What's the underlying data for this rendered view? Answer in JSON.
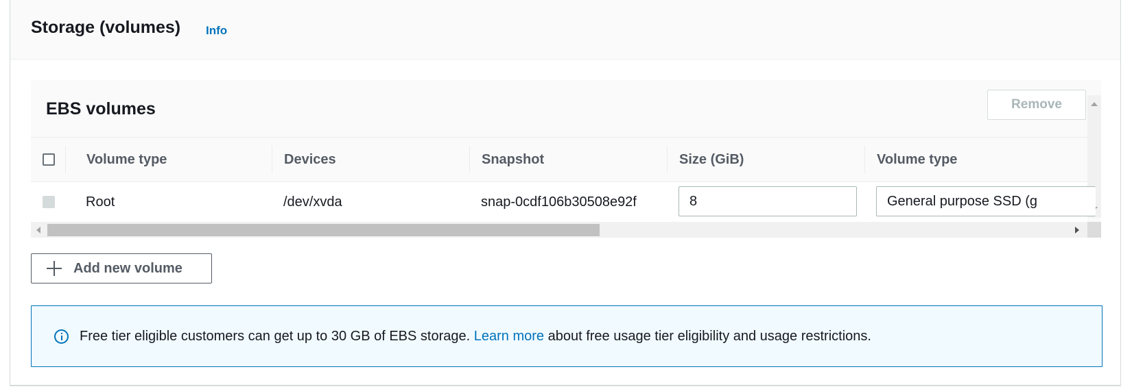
{
  "storage": {
    "title": "Storage (volumes)",
    "info_link": "Info"
  },
  "ebs": {
    "title": "EBS volumes",
    "remove_label": "Remove",
    "columns": [
      "Volume type",
      "Devices",
      "Snapshot",
      "Size (GiB)",
      "Volume type"
    ],
    "rows": [
      {
        "volume_type": "Root",
        "device": "/dev/xvda",
        "snapshot": "snap-0cdf106b30508e92f",
        "size": "8",
        "volume_type_select": "General purpose SSD (g"
      }
    ]
  },
  "add_volume_label": "Add new volume",
  "notice": {
    "text_before": "Free tier eligible customers can get up to 30 GB of EBS storage. ",
    "link": "Learn more",
    "text_after": " about free usage tier eligibility and usage restrictions."
  },
  "colors": {
    "accent": "#0073bb",
    "notice_bg": "#f1faff",
    "disabled": "#aab7b8"
  },
  "icons": {
    "info": "info-circle-icon",
    "add": "plus-icon"
  }
}
